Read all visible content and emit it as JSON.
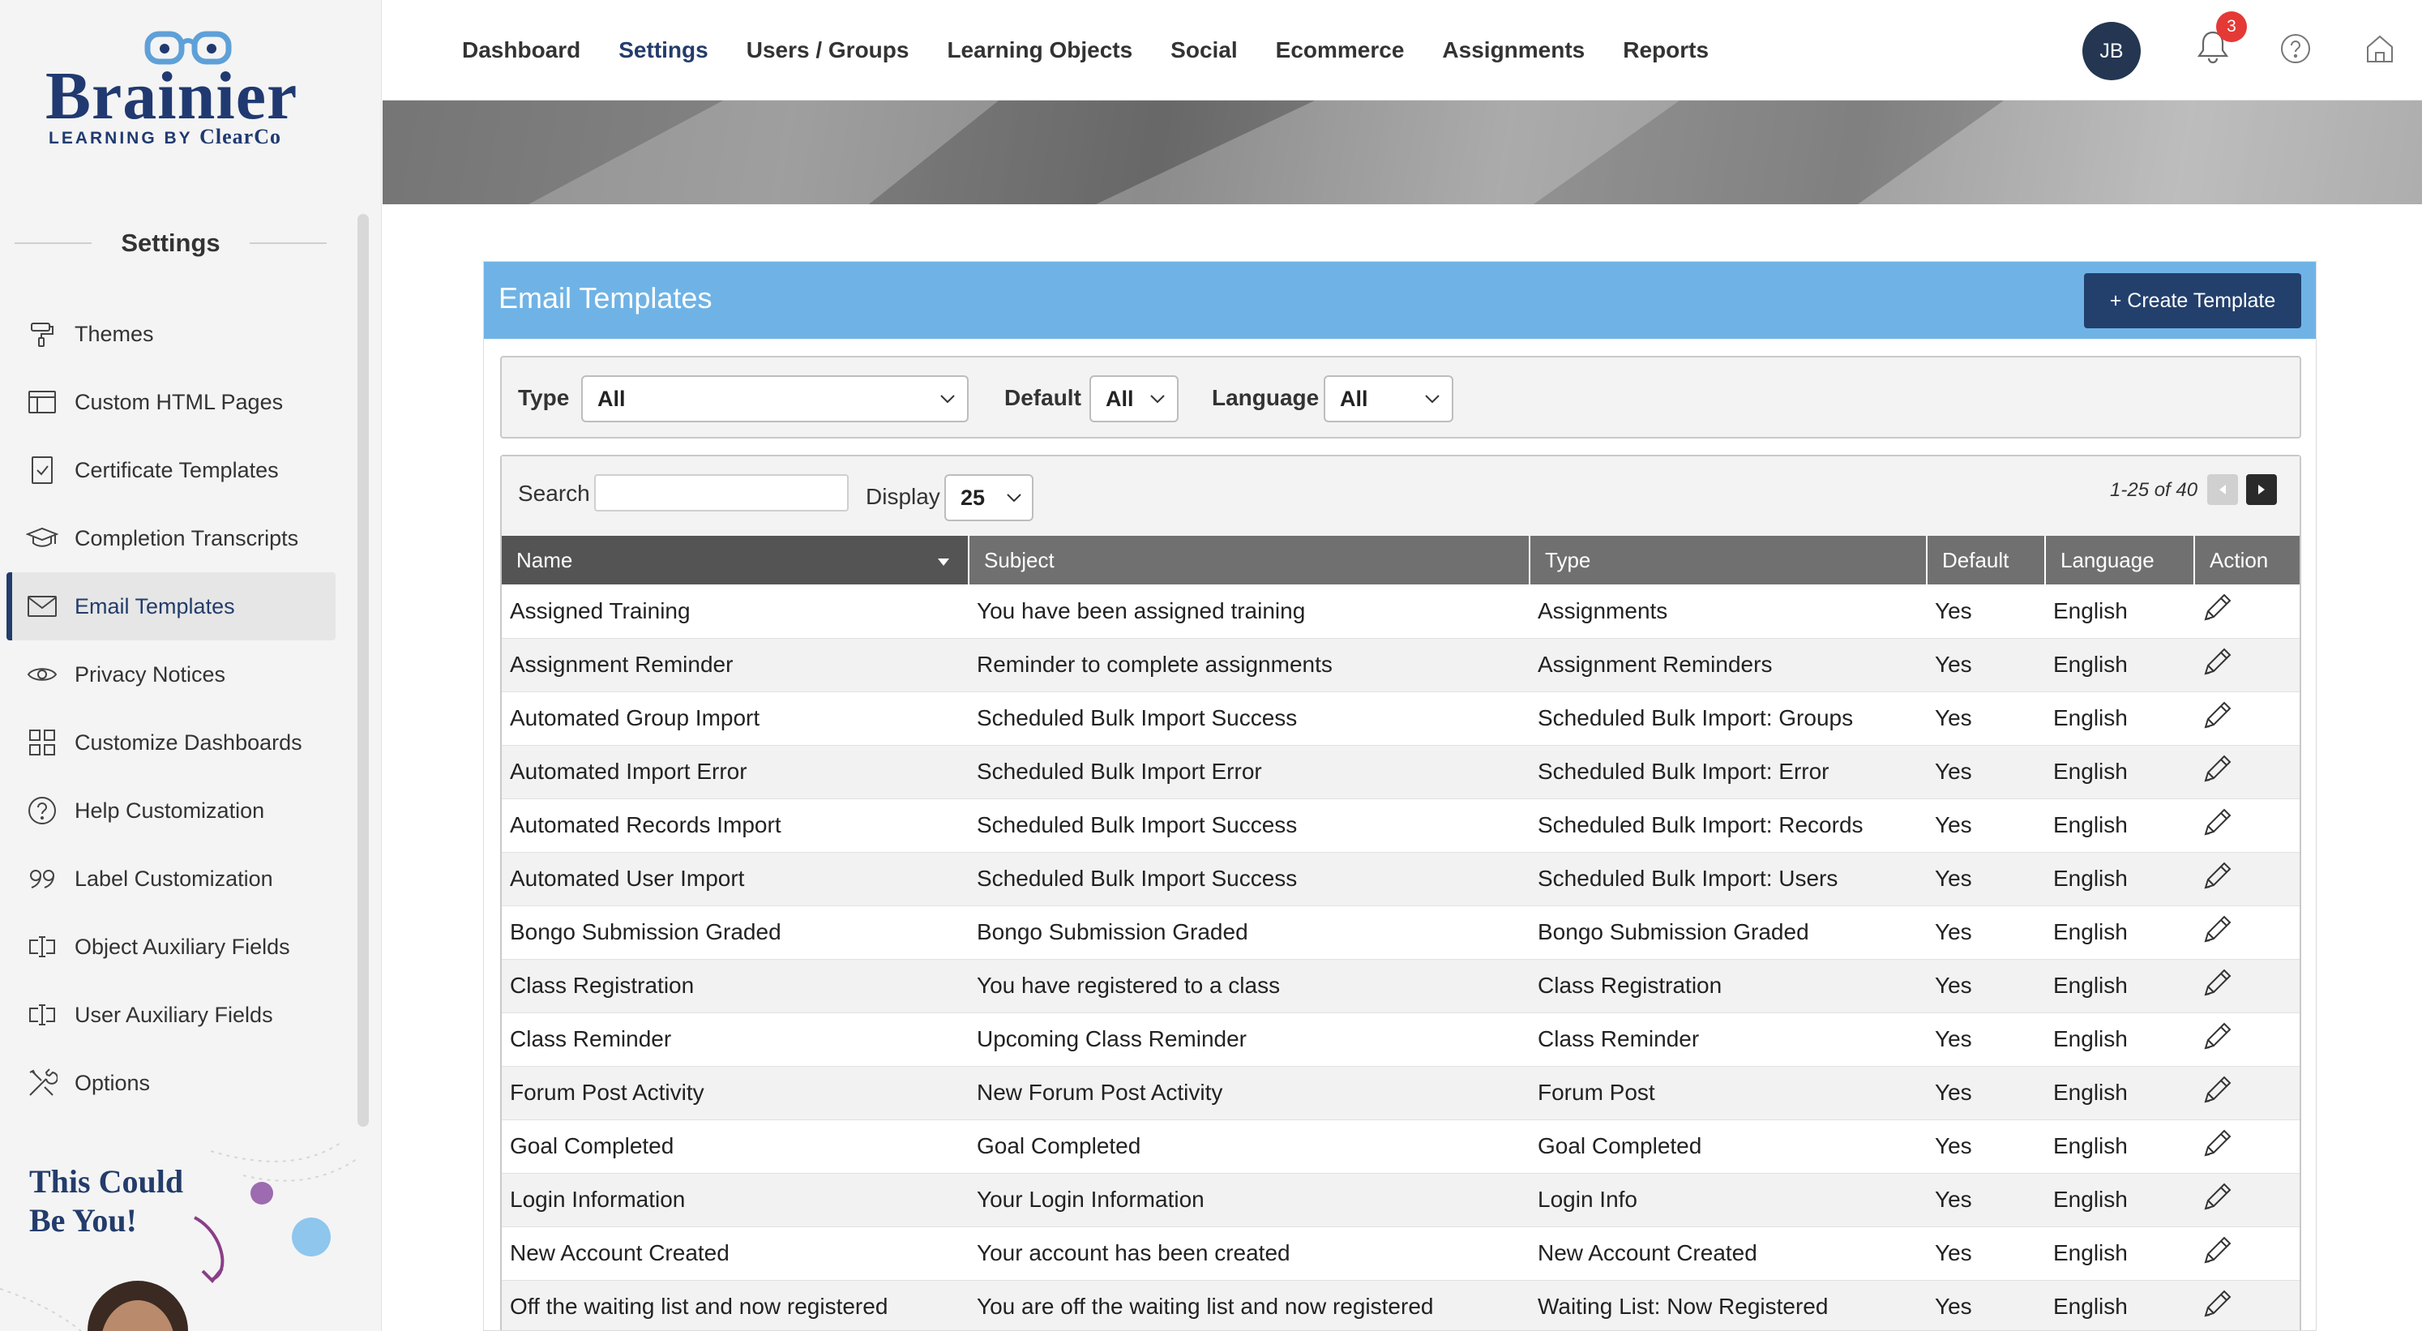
{
  "brand": {
    "name": "Brainier",
    "tagline": "LEARNING BY",
    "tagline_company": "ClearCo"
  },
  "sidebar": {
    "heading": "Settings",
    "items": [
      {
        "label": "Themes",
        "icon": "paint-roller-icon"
      },
      {
        "label": "Custom HTML Pages",
        "icon": "browser-window-icon"
      },
      {
        "label": "Certificate Templates",
        "icon": "certificate-icon"
      },
      {
        "label": "Completion Transcripts",
        "icon": "graduation-cap-icon"
      },
      {
        "label": "Email Templates",
        "icon": "envelope-icon",
        "active": true
      },
      {
        "label": "Privacy Notices",
        "icon": "eye-icon"
      },
      {
        "label": "Customize Dashboards",
        "icon": "dashboard-grid-icon"
      },
      {
        "label": "Help Customization",
        "icon": "question-circle-icon"
      },
      {
        "label": "Label Customization",
        "icon": "quote-icon"
      },
      {
        "label": "Object Auxiliary Fields",
        "icon": "text-cursor-field-icon"
      },
      {
        "label": "User Auxiliary Fields",
        "icon": "text-cursor-field-icon"
      },
      {
        "label": "Options",
        "icon": "tools-icon"
      }
    ],
    "promo": {
      "line1": "This Could",
      "line2": "Be You!"
    }
  },
  "topnav": {
    "items": [
      "Dashboard",
      "Settings",
      "Users / Groups",
      "Learning Objects",
      "Social",
      "Ecommerce",
      "Assignments",
      "Reports"
    ],
    "current": "Settings",
    "avatar_initials": "JB",
    "notification_count": "3"
  },
  "panel": {
    "title": "Email Templates",
    "create_button": "+ Create Template"
  },
  "filters": {
    "type_label": "Type",
    "type_value": "All",
    "default_label": "Default",
    "default_value": "All",
    "language_label": "Language",
    "language_value": "All"
  },
  "list": {
    "search_label": "Search",
    "search_value": "",
    "display_label": "Display",
    "display_value": "25",
    "pager_text": "1-25 of 40",
    "columns": [
      "Name",
      "Subject",
      "Type",
      "Default",
      "Language",
      "Action"
    ],
    "rows": [
      [
        "Assigned Training",
        "You have been assigned training",
        "Assignments",
        "Yes",
        "English"
      ],
      [
        "Assignment Reminder",
        "Reminder to complete assignments",
        "Assignment Reminders",
        "Yes",
        "English"
      ],
      [
        "Automated Group Import",
        "Scheduled Bulk Import Success",
        "Scheduled Bulk Import: Groups",
        "Yes",
        "English"
      ],
      [
        "Automated Import Error",
        "Scheduled Bulk Import Error",
        "Scheduled Bulk Import: Error",
        "Yes",
        "English"
      ],
      [
        "Automated Records Import",
        "Scheduled Bulk Import Success",
        "Scheduled Bulk Import: Records",
        "Yes",
        "English"
      ],
      [
        "Automated User Import",
        "Scheduled Bulk Import Success",
        "Scheduled Bulk Import: Users",
        "Yes",
        "English"
      ],
      [
        "Bongo Submission Graded",
        "Bongo Submission Graded",
        "Bongo Submission Graded",
        "Yes",
        "English"
      ],
      [
        "Class Registration",
        "You have registered to a class",
        "Class Registration",
        "Yes",
        "English"
      ],
      [
        "Class Reminder",
        "Upcoming Class Reminder",
        "Class Reminder",
        "Yes",
        "English"
      ],
      [
        "Forum Post Activity",
        "New Forum Post Activity",
        "Forum Post",
        "Yes",
        "English"
      ],
      [
        "Goal Completed",
        "Goal Completed",
        "Goal Completed",
        "Yes",
        "English"
      ],
      [
        "Login Information",
        "Your Login Information",
        "Login Info",
        "Yes",
        "English"
      ],
      [
        "New Account Created",
        "Your account has been created",
        "New Account Created",
        "Yes",
        "English"
      ],
      [
        "Off the waiting list and now registered",
        "You are off the waiting list and now registered",
        "Waiting List: Now Registered",
        "Yes",
        "English"
      ]
    ]
  },
  "colors": {
    "brand_navy": "#233c6b",
    "panel_header": "#6fb3e6",
    "badge_red": "#e53935"
  }
}
